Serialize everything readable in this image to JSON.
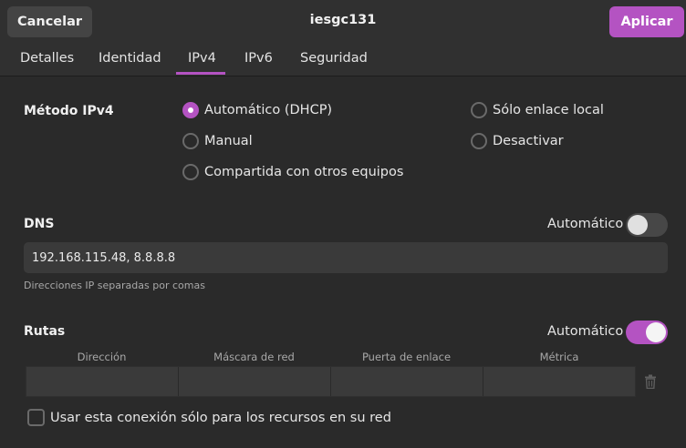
{
  "header": {
    "cancel_label": "Cancelar",
    "title": "iesgc131",
    "apply_label": "Aplicar"
  },
  "tabs": [
    {
      "label": "Detalles"
    },
    {
      "label": "Identidad"
    },
    {
      "label": "IPv4",
      "selected": true
    },
    {
      "label": "IPv6"
    },
    {
      "label": "Seguridad"
    }
  ],
  "method": {
    "label": "Método IPv4",
    "options": [
      {
        "label": "Automático (DHCP)",
        "selected": true
      },
      {
        "label": "Manual",
        "selected": false
      },
      {
        "label": "Compartida con otros equipos",
        "selected": false
      },
      {
        "label": "Sólo enlace local",
        "selected": false
      },
      {
        "label": "Desactivar",
        "selected": false
      }
    ]
  },
  "dns": {
    "label": "DNS",
    "auto_label": "Automático",
    "auto_enabled": false,
    "value": "192.168.115.48, 8.8.8.8",
    "hint": "Direcciones IP separadas por comas"
  },
  "routes": {
    "label": "Rutas",
    "auto_label": "Automático",
    "auto_enabled": true,
    "columns": [
      "Dirección",
      "Máscara de red",
      "Puerta de enlace",
      "Métrica"
    ],
    "trash_icon": "trash-icon"
  },
  "only_resources": {
    "label": "Usar esta conexión sólo para los recursos en su red",
    "checked": false
  },
  "colors": {
    "accent": "#b453c2",
    "background": "#2a2a2a",
    "header": "#303030",
    "field": "#3a3a3a"
  }
}
